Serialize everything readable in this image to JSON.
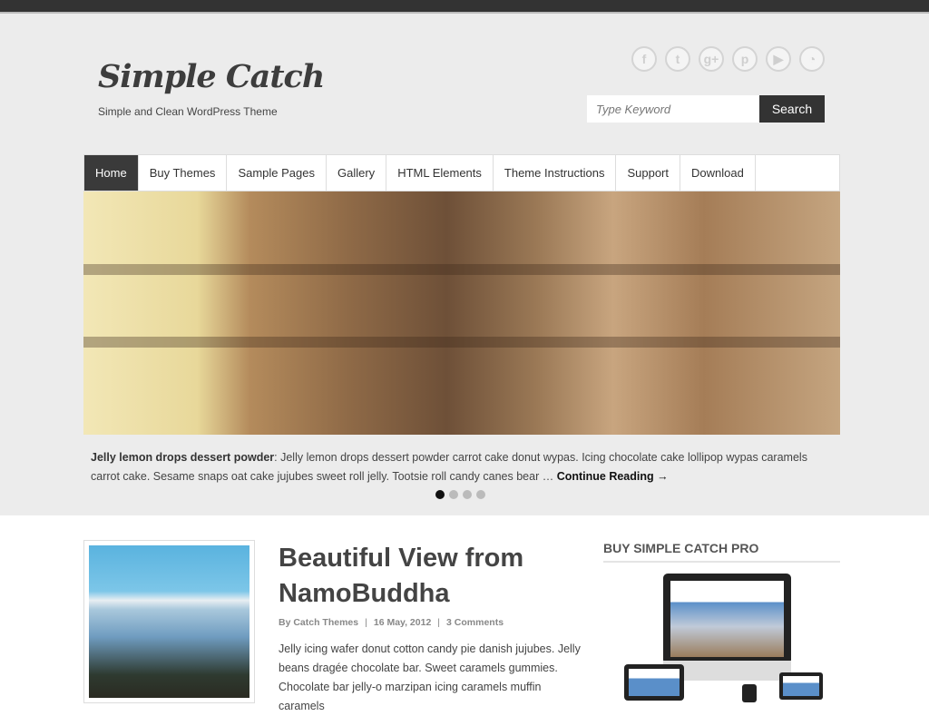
{
  "site": {
    "title": "Simple Catch",
    "tagline": "Simple and Clean WordPress Theme"
  },
  "social": [
    {
      "icon": "facebook-icon",
      "glyph": "f"
    },
    {
      "icon": "twitter-icon",
      "glyph": "t"
    },
    {
      "icon": "googleplus-icon",
      "glyph": "g+"
    },
    {
      "icon": "pinterest-icon",
      "glyph": "p"
    },
    {
      "icon": "youtube-icon",
      "glyph": "▶"
    },
    {
      "icon": "rss-icon",
      "glyph": "◔"
    }
  ],
  "search": {
    "placeholder": "Type Keyword",
    "button": "Search"
  },
  "nav": [
    "Home",
    "Buy Themes",
    "Sample Pages",
    "Gallery",
    "HTML Elements",
    "Theme Instructions",
    "Support",
    "Download"
  ],
  "slider": {
    "caption_title": "Jelly lemon drops dessert powder",
    "caption_text": ": Jelly lemon drops dessert powder carrot cake donut wypas. Icing chocolate cake lollipop wypas caramels carrot cake. Sesame snaps oat cake jujubes sweet roll jelly. Tootsie roll candy canes bear … ",
    "more": "Continue Reading →",
    "active_slide": 1,
    "slide_count": 4
  },
  "post": {
    "title": "Beautiful View from NamoBuddha",
    "author": "By Catch Themes",
    "date": "16 May, 2012",
    "comments": "3 Comments",
    "separator": "|",
    "excerpt": "Jelly icing wafer donut cotton candy pie danish jujubes. Jelly beans dragée chocolate bar. Sweet caramels gummies. Chocolate bar jelly-o marzipan icing caramels muffin caramels"
  },
  "widget": {
    "title": "BUY SIMPLE CATCH PRO"
  }
}
